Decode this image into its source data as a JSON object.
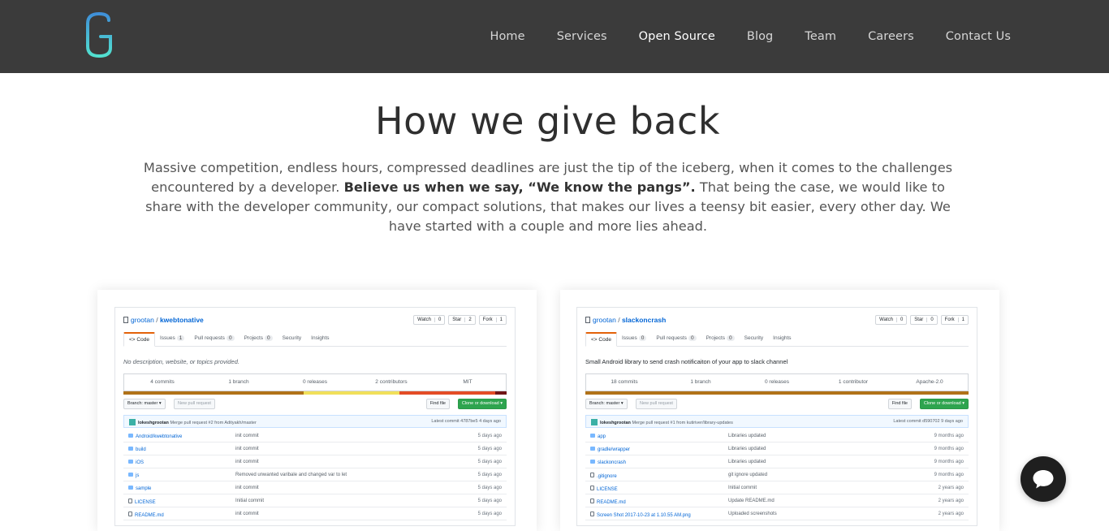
{
  "brand": {
    "logo_letter": "G"
  },
  "nav": {
    "items": [
      {
        "label": "Home",
        "active": false
      },
      {
        "label": "Services",
        "active": false
      },
      {
        "label": "Open Source",
        "active": true
      },
      {
        "label": "Blog",
        "active": false
      },
      {
        "label": "Team",
        "active": false
      },
      {
        "label": "Careers",
        "active": false
      },
      {
        "label": "Contact Us",
        "active": false
      }
    ]
  },
  "hero": {
    "title": "How we give back",
    "text_1": "Massive competition, endless hours, compressed deadlines are just the tip of the iceberg, when it comes to the challenges encountered by a developer. ",
    "text_bold": "Believe us when we say, “We know the pangs”.",
    "text_2": " That being the case, we would like to share with the developer community, our compact solutions, that makes our lives a teensy bit easier, every other day. We have started with a couple and more lies ahead."
  },
  "repos": [
    {
      "owner": "grootan",
      "name": "kwebtonative",
      "watch": "Watch",
      "watch_count": "0",
      "star": "Star",
      "star_count": "2",
      "fork": "Fork",
      "fork_count": "1",
      "tabs": [
        {
          "label": "<> Code",
          "badge": ""
        },
        {
          "label": "Issues",
          "badge": "1"
        },
        {
          "label": "Pull requests",
          "badge": "0"
        },
        {
          "label": "Projects",
          "badge": "0"
        },
        {
          "label": "Security",
          "badge": ""
        },
        {
          "label": "Insights",
          "badge": ""
        }
      ],
      "description": "No description, website, or topics provided.",
      "stats": [
        {
          "label": "4 commits"
        },
        {
          "label": "1 branch"
        },
        {
          "label": "0 releases"
        },
        {
          "label": "2 contributors"
        },
        {
          "label": "MIT"
        }
      ],
      "branch": "Branch: master ▾",
      "new_pr": "New pull request",
      "find_file": "Find file",
      "clone": "Clone or download ▾",
      "commit_author": "lokeshgrootan",
      "commit_message": "Merge pull request #2 from Adityakh/master",
      "latest_commit": "Latest commit 4787be5 4 days ago",
      "files": [
        {
          "name": "Android/kwebtonative",
          "msg": "init commit",
          "age": "5 days ago",
          "dir": true
        },
        {
          "name": "build",
          "msg": "init commit",
          "age": "5 days ago",
          "dir": true
        },
        {
          "name": "iOS",
          "msg": "init commit",
          "age": "5 days ago",
          "dir": true
        },
        {
          "name": "js",
          "msg": "Removed unwanted varibale and changed var to let",
          "age": "5 days ago",
          "dir": true
        },
        {
          "name": "sample",
          "msg": "init commit",
          "age": "5 days ago",
          "dir": true
        },
        {
          "name": "LICENSE",
          "msg": "Initial commit",
          "age": "5 days ago",
          "dir": false
        },
        {
          "name": "README.md",
          "msg": "init commit",
          "age": "5 days ago",
          "dir": false
        }
      ],
      "lang_colors": [
        "#b07219",
        "#f1e05a",
        "#e34c26",
        "#701516"
      ],
      "lang_shares": [
        0.47,
        0.25,
        0.25,
        0.03
      ]
    },
    {
      "owner": "grootan",
      "name": "slackoncrash",
      "watch": "Watch",
      "watch_count": "0",
      "star": "Star",
      "star_count": "0",
      "fork": "Fork",
      "fork_count": "1",
      "tabs": [
        {
          "label": "<> Code",
          "badge": ""
        },
        {
          "label": "Issues",
          "badge": "0"
        },
        {
          "label": "Pull requests",
          "badge": "0"
        },
        {
          "label": "Projects",
          "badge": "0"
        },
        {
          "label": "Security",
          "badge": ""
        },
        {
          "label": "Insights",
          "badge": ""
        }
      ],
      "description": "Small Android library to send crash notificaiton of your app to slack channel",
      "stats": [
        {
          "label": "18 commits"
        },
        {
          "label": "1 branch"
        },
        {
          "label": "0 releases"
        },
        {
          "label": "1 contributor"
        },
        {
          "label": "Apache-2.0"
        }
      ],
      "branch": "Branch: master ▾",
      "new_pr": "New pull request",
      "find_file": "Find file",
      "clone": "Clone or download ▾",
      "commit_author": "lokeshgrootan",
      "commit_message": "Merge pull request #1 from kutiriver/library-updates",
      "latest_commit": "Latest commit d590702 9 days ago",
      "files": [
        {
          "name": "app",
          "msg": "Libraries updated",
          "age": "9 months ago",
          "dir": true
        },
        {
          "name": "gradle/wrapper",
          "msg": "Libraries updated",
          "age": "9 months ago",
          "dir": true
        },
        {
          "name": "slackoncrash",
          "msg": "Libraries updated",
          "age": "9 months ago",
          "dir": true
        },
        {
          "name": ".gitignore",
          "msg": "git ignore updated",
          "age": "9 months ago",
          "dir": false
        },
        {
          "name": "LICENSE",
          "msg": "Initial commit",
          "age": "2 years ago",
          "dir": false
        },
        {
          "name": "README.md",
          "msg": "Update README.md",
          "age": "2 years ago",
          "dir": false
        },
        {
          "name": "Screen Shot 2017-10-23 at 1.10.55 AM.png",
          "msg": "Uploaded screenshots",
          "age": "2 years ago",
          "dir": false
        }
      ],
      "lang_colors": [
        "#b07219"
      ],
      "lang_shares": [
        1.0
      ]
    }
  ],
  "chat": {
    "icon": "chat-bubble-icon"
  }
}
